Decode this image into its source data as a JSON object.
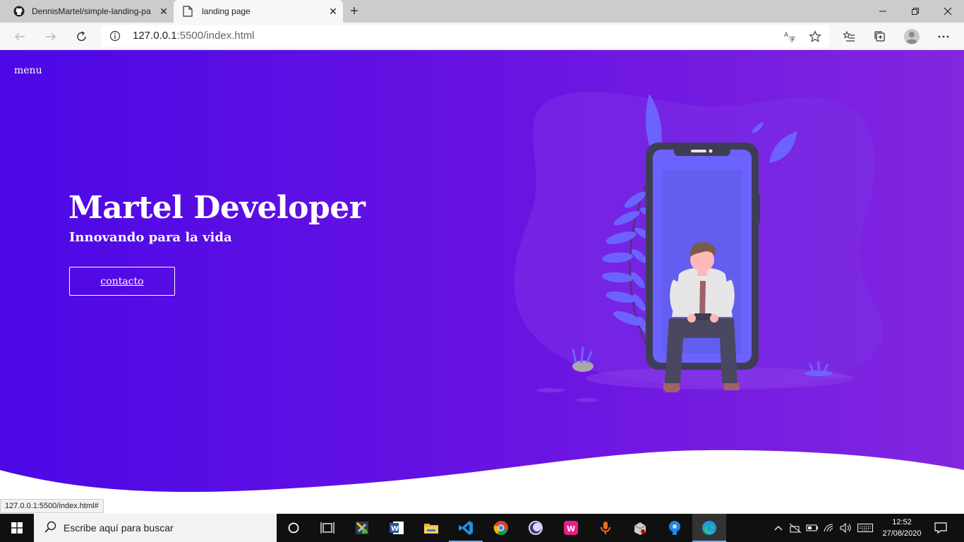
{
  "browser": {
    "tabs": [
      {
        "title": "DennisMartel/simple-landing-pa",
        "icon": "github-icon"
      },
      {
        "title": "landing page",
        "icon": "page-icon"
      }
    ],
    "url_host": "127.0.0.1",
    "url_rest": ":5500/index.html",
    "status_url": "127.0.0.1:5500/index.html#"
  },
  "page": {
    "menu_label": "menu",
    "title": "Martel Developer",
    "subtitle": "Innovando para la vida",
    "cta_label": "contacto",
    "colors": {
      "gradient_start": "#4c08e6",
      "gradient_end": "#8226df",
      "accent": "#6c63ff"
    }
  },
  "taskbar": {
    "search_placeholder": "Escribe aquí para buscar",
    "apps": [
      "task-view-icon",
      "network-tool-icon",
      "word-icon",
      "file-explorer-icon",
      "vscode-icon",
      "chrome-icon",
      "eclipse-icon",
      "wamp-icon",
      "podcast-icon",
      "package-icon",
      "sourcetree-icon",
      "edge-icon"
    ],
    "time": "12:52",
    "date": "27/08/2020"
  }
}
